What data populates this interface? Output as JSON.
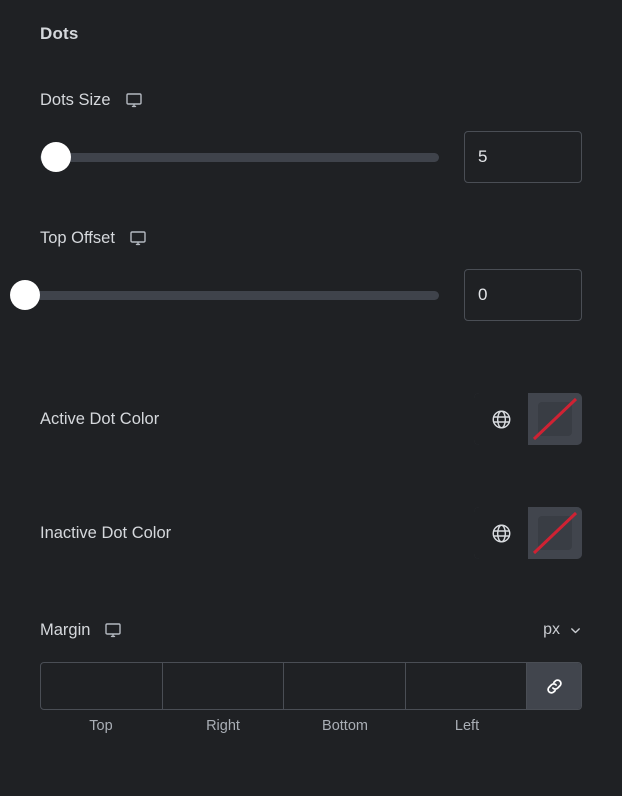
{
  "section": {
    "title": "Dots"
  },
  "controls": {
    "dots_size": {
      "label": "Dots Size",
      "device_icon": "monitor-icon",
      "value": "5",
      "placeholder": "",
      "slider": {
        "min": 0,
        "max": 100,
        "value": 5,
        "handle_percent": 4
      }
    },
    "top_offset": {
      "label": "Top Offset",
      "device_icon": "monitor-icon",
      "value": "0",
      "placeholder": "",
      "slider": {
        "min": 0,
        "max": 100,
        "value": 0,
        "handle_percent": 0
      }
    },
    "active_dot_color": {
      "label": "Active Dot Color",
      "globe_icon": "globe-icon",
      "swatch": "no-color",
      "slash_color": "#cf2233"
    },
    "inactive_dot_color": {
      "label": "Inactive Dot Color",
      "globe_icon": "globe-icon",
      "swatch": "no-color",
      "slash_color": "#cf2233"
    },
    "margin": {
      "label": "Margin",
      "device_icon": "monitor-icon",
      "unit": "px",
      "unit_chevron": "chevron-down-icon",
      "link_icon": "link-icon",
      "fields": [
        {
          "name": "top",
          "label": "Top",
          "value": "",
          "placeholder": ""
        },
        {
          "name": "right",
          "label": "Right",
          "value": "",
          "placeholder": ""
        },
        {
          "name": "bottom",
          "label": "Bottom",
          "value": "",
          "placeholder": ""
        },
        {
          "name": "left",
          "label": "Left",
          "value": "",
          "placeholder": ""
        }
      ]
    }
  },
  "colors": {
    "background": "#1f2124",
    "text": "#d5d8dc",
    "muted_text": "#a9aeb5",
    "border": "#4a4e55",
    "track": "#3f434b",
    "handle": "#ffffff",
    "swatch_bg": "#41454d",
    "accent_red": "#cf2233"
  }
}
